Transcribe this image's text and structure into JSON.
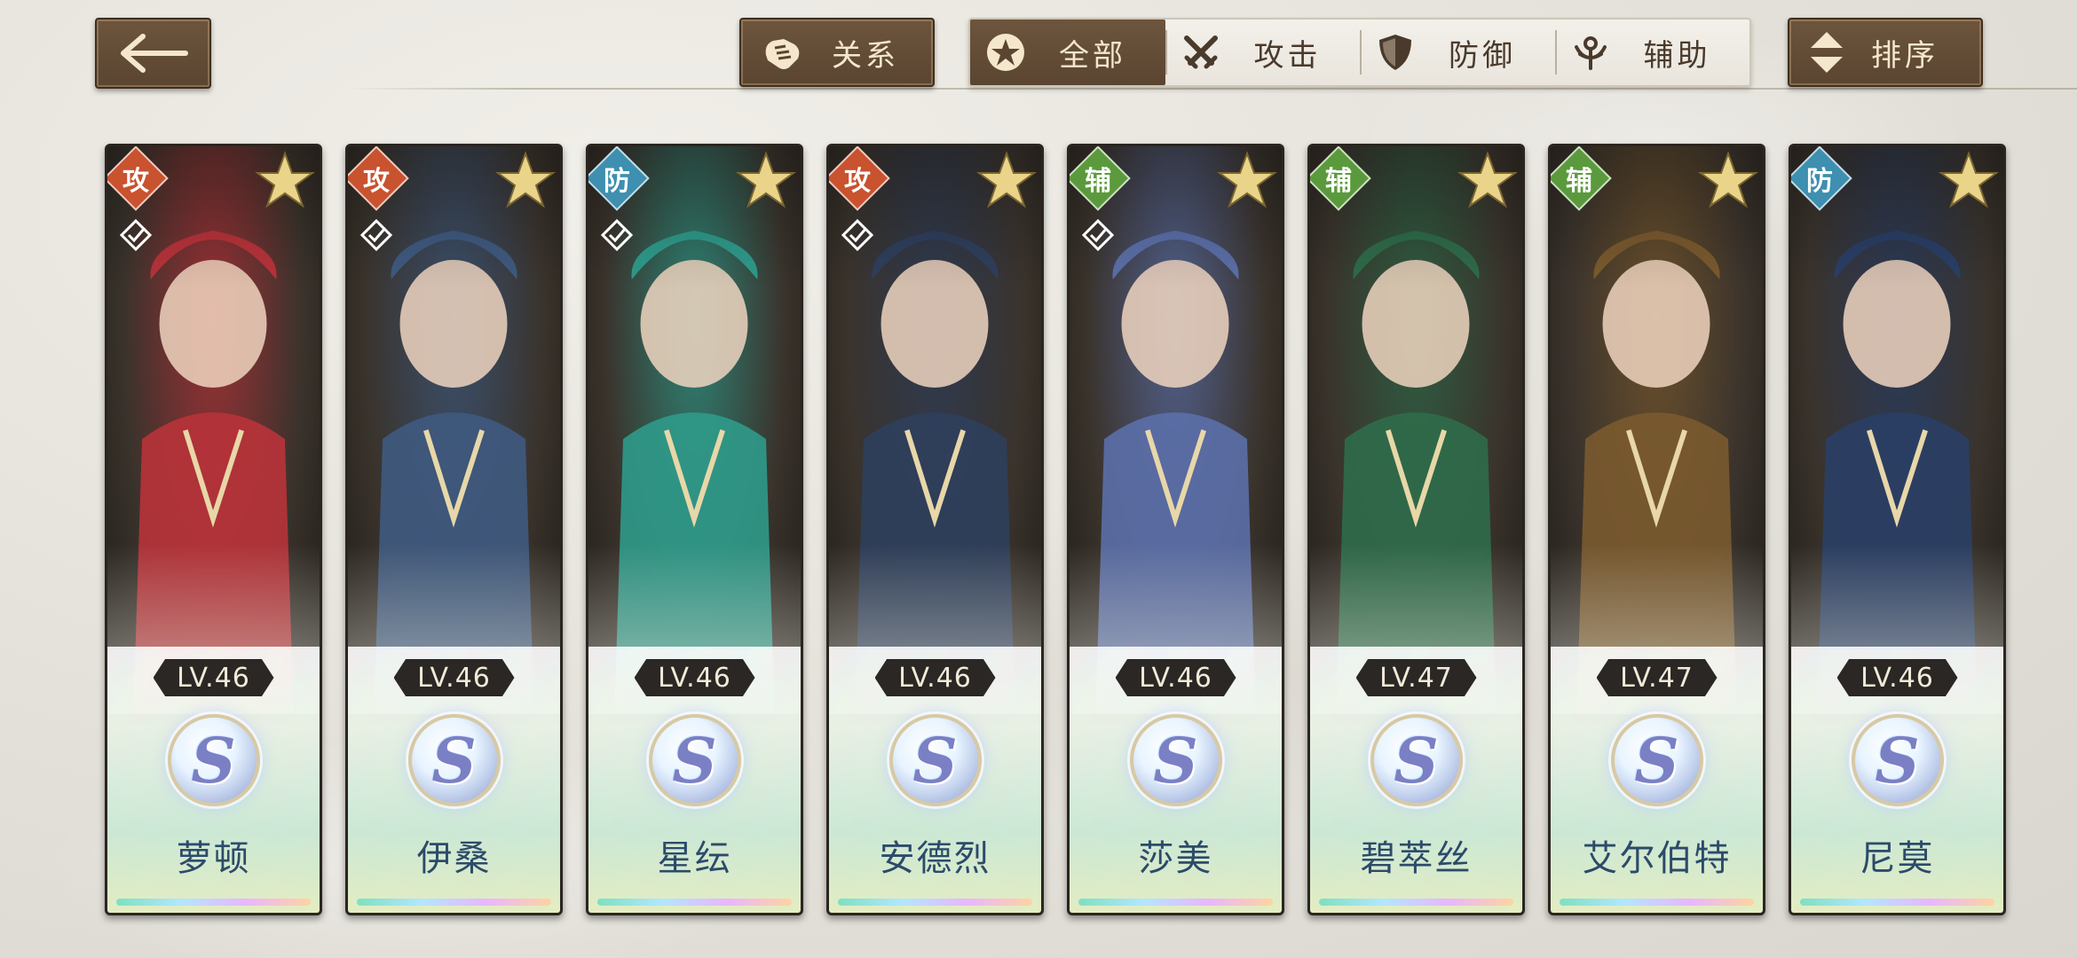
{
  "header": {
    "back_icon": "arrow-left-icon",
    "relation_label": "关系",
    "sort_label": "排序",
    "filters": [
      {
        "label": "全部",
        "icon": "star-circle-icon",
        "active": true
      },
      {
        "label": "攻击",
        "icon": "crossed-swords-icon",
        "active": false
      },
      {
        "label": "防御",
        "icon": "shield-icon",
        "active": false
      },
      {
        "label": "辅助",
        "icon": "support-icon",
        "active": false
      }
    ]
  },
  "colors": {
    "attack": "#c9522f",
    "defense": "#3e8fb0",
    "support": "#5b9a3c",
    "button_brown": "#5a4531",
    "name_text": "#2c4b6a"
  },
  "characters": [
    {
      "name": "萝顿",
      "type": "攻",
      "level": "LV.46",
      "rank": "S",
      "selected_mark": true,
      "art_color": "#b8333a"
    },
    {
      "name": "伊桑",
      "type": "攻",
      "level": "LV.46",
      "rank": "S",
      "selected_mark": true,
      "art_color": "#3f5a80"
    },
    {
      "name": "星纭",
      "type": "防",
      "level": "LV.46",
      "rank": "S",
      "selected_mark": true,
      "art_color": "#2f9a8a"
    },
    {
      "name": "安德烈",
      "type": "攻",
      "level": "LV.46",
      "rank": "S",
      "selected_mark": true,
      "art_color": "#2f3f5c"
    },
    {
      "name": "莎美",
      "type": "辅",
      "level": "LV.46",
      "rank": "S",
      "selected_mark": true,
      "art_color": "#5b6fa8"
    },
    {
      "name": "碧萃丝",
      "type": "辅",
      "level": "LV.47",
      "rank": "S",
      "selected_mark": false,
      "art_color": "#2f6b4a"
    },
    {
      "name": "艾尔伯特",
      "type": "辅",
      "level": "LV.47",
      "rank": "S",
      "selected_mark": false,
      "art_color": "#7a5a2f"
    },
    {
      "name": "尼莫",
      "type": "防",
      "level": "LV.46",
      "rank": "S",
      "selected_mark": false,
      "art_color": "#2a3f66"
    }
  ]
}
